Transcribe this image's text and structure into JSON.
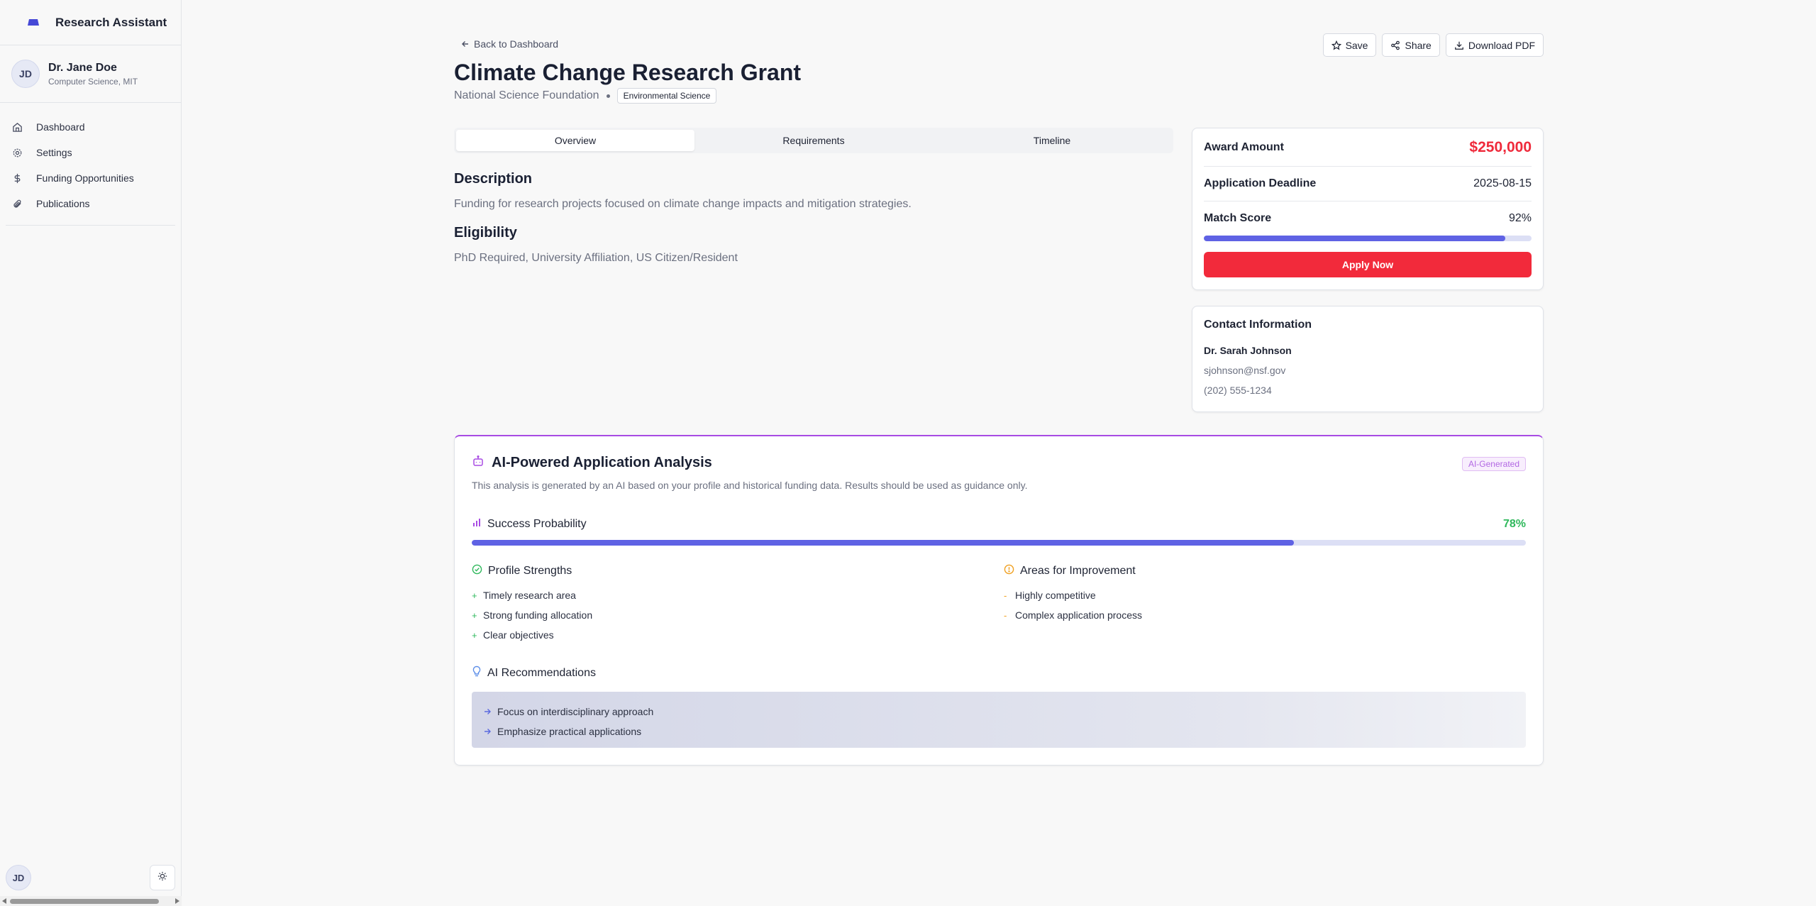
{
  "app": {
    "title": "Research Assistant"
  },
  "user": {
    "initials": "JD",
    "name": "Dr. Jane Doe",
    "department": "Computer Science, MIT"
  },
  "nav": [
    {
      "label": "Dashboard",
      "icon": "home-icon"
    },
    {
      "label": "Settings",
      "icon": "gear-icon"
    },
    {
      "label": "Funding Opportunities",
      "icon": "dollar-icon"
    },
    {
      "label": "Publications",
      "icon": "paperclip-icon"
    }
  ],
  "page": {
    "back_label": "Back to Dashboard",
    "title": "Climate Change Research Grant",
    "funder": "National Science Foundation",
    "category": "Environmental Science",
    "actions": {
      "save": "Save",
      "share": "Share",
      "download": "Download PDF"
    },
    "tabs": [
      "Overview",
      "Requirements",
      "Timeline"
    ],
    "active_tab": "Overview",
    "description_heading": "Description",
    "description": "Funding for research projects focused on climate change impacts and mitigation strategies.",
    "eligibility_heading": "Eligibility",
    "eligibility": "PhD Required, University Affiliation, US Citizen/Resident"
  },
  "award": {
    "amount_label": "Award Amount",
    "amount": "$250,000",
    "deadline_label": "Application Deadline",
    "deadline": "2025-08-15",
    "match_label": "Match Score",
    "match_value": "92%",
    "match_fraction": 0.92,
    "apply_label": "Apply Now"
  },
  "contact": {
    "heading": "Contact Information",
    "name": "Dr. Sarah Johnson",
    "email": "sjohnson@nsf.gov",
    "phone": "(202) 555-1234"
  },
  "ai": {
    "title": "AI-Powered Application Analysis",
    "badge": "AI-Generated",
    "description": "This analysis is generated by an AI based on your profile and historical funding data. Results should be used as guidance only.",
    "success_label": "Success Probability",
    "success_value": "78%",
    "success_fraction": 0.78,
    "strengths_heading": "Profile Strengths",
    "strengths": [
      "Timely research area",
      "Strong funding allocation",
      "Clear objectives"
    ],
    "improvements_heading": "Areas for Improvement",
    "improvements": [
      "Highly competitive",
      "Complex application process"
    ],
    "recommendations_heading": "AI Recommendations",
    "recommendations": [
      "Focus on interdisciplinary approach",
      "Emphasize practical applications"
    ]
  },
  "colors": {
    "accent": "#5f62e4",
    "danger": "#f22a3b",
    "success": "#2fb85c",
    "warning": "#f0a020",
    "ai": "#a84be3"
  }
}
